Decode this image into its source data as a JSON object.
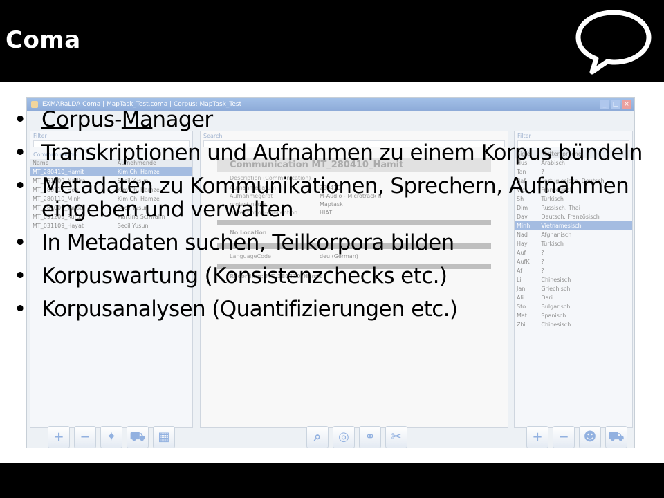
{
  "slide": {
    "title": "Coma",
    "bullets": [
      {
        "parts": [
          {
            "text": "Co",
            "underline": true
          },
          {
            "text": "rpus-",
            "underline": false
          },
          {
            "text": "Ma",
            "underline": true
          },
          {
            "text": "nager",
            "underline": false
          }
        ]
      },
      {
        "parts": [
          {
            "text": "Transkriptionen und Aufnahmen zu einem Korpus bündeln",
            "underline": false
          }
        ]
      },
      {
        "parts": [
          {
            "text": "Metadaten zu Kommunikationen, Sprechern, Aufnahmen eingeben und verwalten",
            "underline": false
          }
        ]
      },
      {
        "parts": [
          {
            "text": "In Metadaten suchen, Teilkorpora bilden",
            "underline": false
          }
        ]
      },
      {
        "parts": [
          {
            "text": "Korpuswartung (Konsistenzchecks etc.)",
            "underline": false
          }
        ]
      },
      {
        "parts": [
          {
            "text": "Korpusanalysen (Quantifizierungen etc.)",
            "underline": false
          }
        ]
      }
    ]
  },
  "app": {
    "window_title": "EXMARaLDA Coma | MapTask_Test.coma | Corpus: MapTask_Test",
    "left_pane": {
      "filter_label": "Filter",
      "list_label": "Communication",
      "columns": [
        "Name",
        "Aufnehmende"
      ],
      "rows": [
        [
          "MT_280410_Hamit",
          "Kim Chi Hamze"
        ],
        [
          "MT_051109_Nadira",
          "Secil Yusun"
        ],
        [
          "MT_280110_Hoa",
          "Kim Chi Hamze"
        ],
        [
          "MT_280110_Minh",
          "Kim Chi Hamze"
        ],
        [
          "MT_281009_Tansu",
          "Secil Yusun"
        ],
        [
          "MT_091209_Rufus",
          "Martina Schwalm"
        ],
        [
          "MT_031109_Hayat",
          "Secil Yusun"
        ]
      ],
      "selected_row": 0
    },
    "middle_pane": {
      "search_label": "Search",
      "heading": "Communication MT_280410_Hamit",
      "sub": "Description (Communication)",
      "fields": [
        [
          "Aufnahmedatum",
          "280410"
        ],
        [
          "Aufnahmegerät",
          "M-Audio - Microtrack II"
        ],
        [
          "project-name",
          "Maptask"
        ],
        [
          "transcription-convention",
          "HIAT"
        ]
      ],
      "location": "No Location",
      "language_code_label": "LanguageCode",
      "language_code_value": "deu (German)",
      "recording": "Recording: MT_280410_Hamit"
    },
    "right_pane": {
      "filter_label": "Filter",
      "columns": [
        "Sigle",
        "Muttersprache"
      ],
      "rows": [
        [
          "Hus",
          "Arabisch"
        ],
        [
          "Tan",
          "?"
        ],
        [
          "Raf",
          "Portugiesisch, Deutsch"
        ],
        [
          "Vic",
          "Französisch"
        ],
        [
          "Sh",
          "Türkisch"
        ],
        [
          "Dim",
          "Russisch, Thai"
        ],
        [
          "Dav",
          "Deutsch, Französisch"
        ],
        [
          "Minh",
          "Vietnamesisch"
        ],
        [
          "Nad",
          "Afghanisch"
        ],
        [
          "Hay",
          "Türkisch"
        ],
        [
          "Auf",
          "?"
        ],
        [
          "AufK",
          "?"
        ],
        [
          "Af",
          "?"
        ],
        [
          "Li",
          "Chinesisch"
        ],
        [
          "Jan",
          "Griechisch"
        ],
        [
          "Ali",
          "Dari"
        ],
        [
          "Sto",
          "Bulgarisch"
        ],
        [
          "Mat",
          "Spanisch"
        ],
        [
          "Zhi",
          "Chinesisch"
        ]
      ],
      "selected_row": 7
    },
    "toolbar_icons": {
      "left": [
        "plus-icon",
        "minus-icon",
        "wand-icon",
        "basket-icon",
        "calculator-icon"
      ],
      "middle": [
        "search-icon",
        "lifebuoy-icon",
        "link-icon",
        "unlink-icon"
      ],
      "right": [
        "plus-icon",
        "minus-icon",
        "people-icon",
        "basket-icon"
      ]
    }
  }
}
